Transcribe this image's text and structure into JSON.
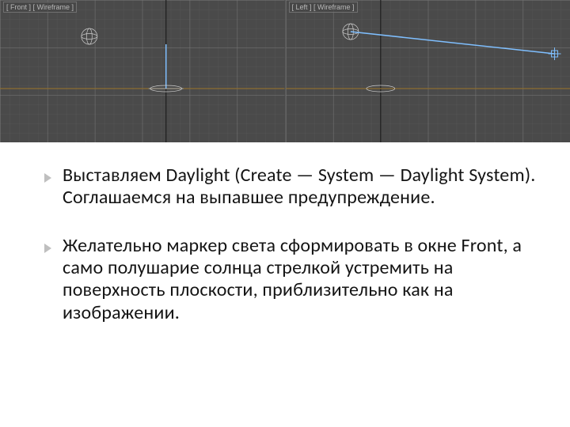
{
  "viewports": {
    "left_label": "[ Front ] [ Wireframe ]",
    "right_label": "[ Left ] [ Wireframe ]"
  },
  "bullets": {
    "b1": "Выставляем Daylight (Create — System — Daylight System). Соглашаемся на выпавшее предупреждение.",
    "b2": "Желательно маркер света сформировать в окне Front, а само полушарие солнца стрелкой устремить на поверхность плоскости, приблизительно как на изображении."
  },
  "colors": {
    "bullet": "#bfbfbf",
    "grid_bg": "#4a4a4a",
    "grid_minor": "#5e5e5e",
    "grid_major": "#7a7a7a",
    "axis_dark": "#1e1e1e",
    "horizon_line": "#b98f3a",
    "daylight": "#7fbfff",
    "compass": "#cfcfcf"
  }
}
